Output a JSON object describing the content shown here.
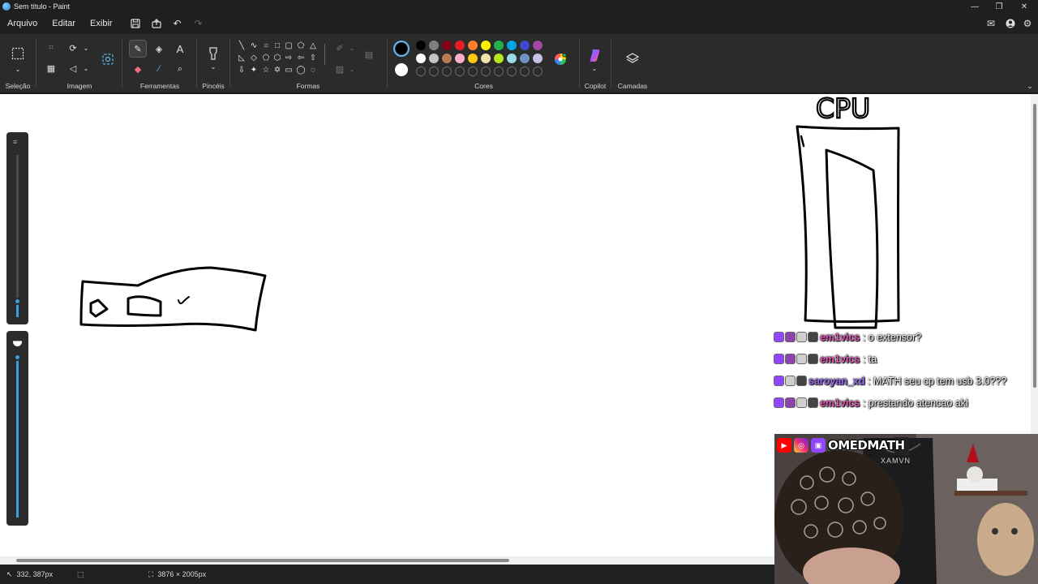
{
  "window": {
    "title": "Sem título - Paint"
  },
  "menu": {
    "file": "Arquivo",
    "edit": "Editar",
    "view": "Exibir"
  },
  "ribbon": {
    "groups": {
      "selection": "Seleção",
      "image": "Imagem",
      "tools": "Ferramentas",
      "brushes": "Pincéis",
      "shapes": "Formas",
      "colors": "Cores",
      "copilot": "Copilot",
      "layers": "Camadas"
    },
    "palette_row1": [
      "#000000",
      "#7f7f7f",
      "#880015",
      "#ed1c24",
      "#ff7f27",
      "#fff200",
      "#22b14c",
      "#00a2e8",
      "#3f48cc",
      "#a349a4"
    ],
    "palette_row2": [
      "#ffffff",
      "#c3c3c3",
      "#b97a57",
      "#ffaec9",
      "#ffc90e",
      "#efe4b0",
      "#b5e61d",
      "#99d9ea",
      "#7092be",
      "#c8bfe7"
    ],
    "primary_color": "#000000",
    "secondary_color": "#ffffff"
  },
  "canvas": {
    "drawn_label": "CPU"
  },
  "chat": [
    {
      "user": "em1vics",
      "user_color": "#e05ab8",
      "message": "o extensor?",
      "badges": [
        "#9146ff",
        "#8e44ad",
        "#cfcfcf",
        "#444444"
      ]
    },
    {
      "user": "em1vics",
      "user_color": "#e05ab8",
      "message": "ta",
      "badges": [
        "#9146ff",
        "#8e44ad",
        "#cfcfcf",
        "#444444"
      ]
    },
    {
      "user": "saroyan_xd",
      "user_color": "#9b6cf0",
      "message": "MATH seu cp tem usb 3.0???",
      "badges": [
        "#9146ff",
        "#cfcfcf",
        "#444444"
      ]
    },
    {
      "user": "em1vics",
      "user_color": "#e05ab8",
      "message": "prestando atencao aki",
      "badges": [
        "#9146ff",
        "#8e44ad",
        "#cfcfcf",
        "#444444"
      ]
    }
  ],
  "webcam": {
    "channel_name": "OMEDMATH",
    "chair_brand": "XAMVN"
  },
  "status": {
    "cursor_position": "332, 387px",
    "canvas_size": "3876 × 2005px"
  }
}
